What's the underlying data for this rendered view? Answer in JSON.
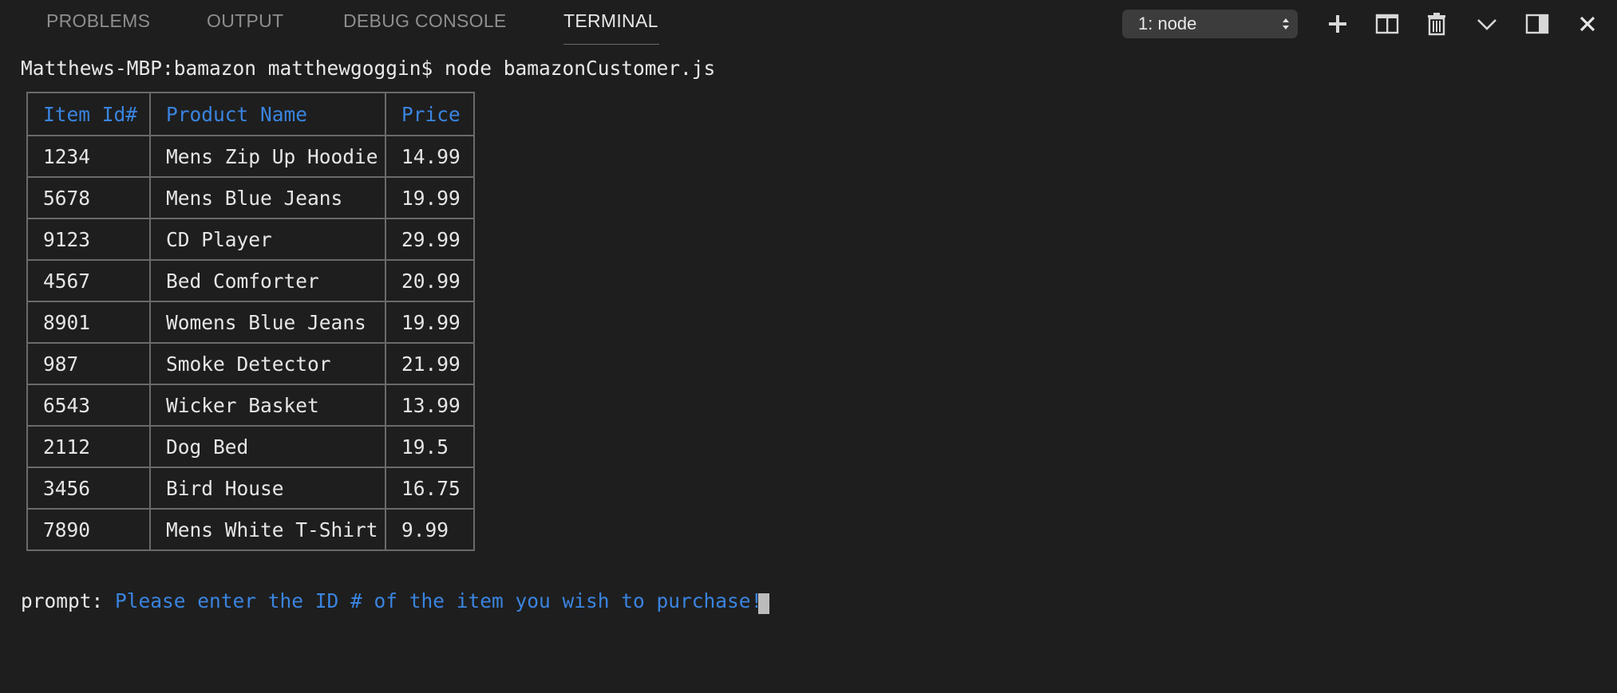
{
  "panel": {
    "tabs": [
      {
        "label": "PROBLEMS"
      },
      {
        "label": "OUTPUT"
      },
      {
        "label": "DEBUG CONSOLE"
      },
      {
        "label": "TERMINAL"
      }
    ],
    "active_tab": "TERMINAL",
    "terminal_select": {
      "selected": "1: node"
    },
    "actions": [
      {
        "icon": "plus-icon",
        "label": "New Terminal"
      },
      {
        "icon": "split-terminal-icon",
        "label": "Split Terminal"
      },
      {
        "icon": "trash-icon",
        "label": "Kill Terminal"
      },
      {
        "icon": "chevron-down-icon",
        "label": "Maximize/Minimize Panel"
      },
      {
        "icon": "panel-layout-icon",
        "label": "Toggle Panel Position"
      },
      {
        "icon": "close-icon",
        "label": "Close Panel"
      }
    ]
  },
  "terminal": {
    "command_line": "Matthews-MBP:bamazon matthewgoggin$ node bamazonCustomer.js",
    "table": {
      "headers": [
        "Item Id#",
        "Product Name",
        "Price"
      ],
      "rows": [
        [
          "1234",
          "Mens Zip Up Hoodie",
          "14.99"
        ],
        [
          "5678",
          "Mens Blue Jeans",
          "19.99"
        ],
        [
          "9123",
          "CD Player",
          "29.99"
        ],
        [
          "4567",
          "Bed Comforter",
          "20.99"
        ],
        [
          "8901",
          "Womens Blue Jeans",
          "19.99"
        ],
        [
          "987",
          "Smoke Detector",
          "21.99"
        ],
        [
          "6543",
          "Wicker Basket",
          "13.99"
        ],
        [
          "2112",
          "Dog Bed",
          "19.5"
        ],
        [
          "3456",
          "Bird House",
          "16.75"
        ],
        [
          "7890",
          "Mens White T-Shirt",
          "9.99"
        ]
      ]
    },
    "prompt_label": "prompt:",
    "prompt_message": "Please enter the ID # of the item you wish to purchase!:"
  },
  "colors": {
    "background": "#1e1e1e",
    "header_text": "#3a84e0",
    "tab_inactive": "#8e8e8e",
    "tab_active": "#e7e7e7"
  }
}
